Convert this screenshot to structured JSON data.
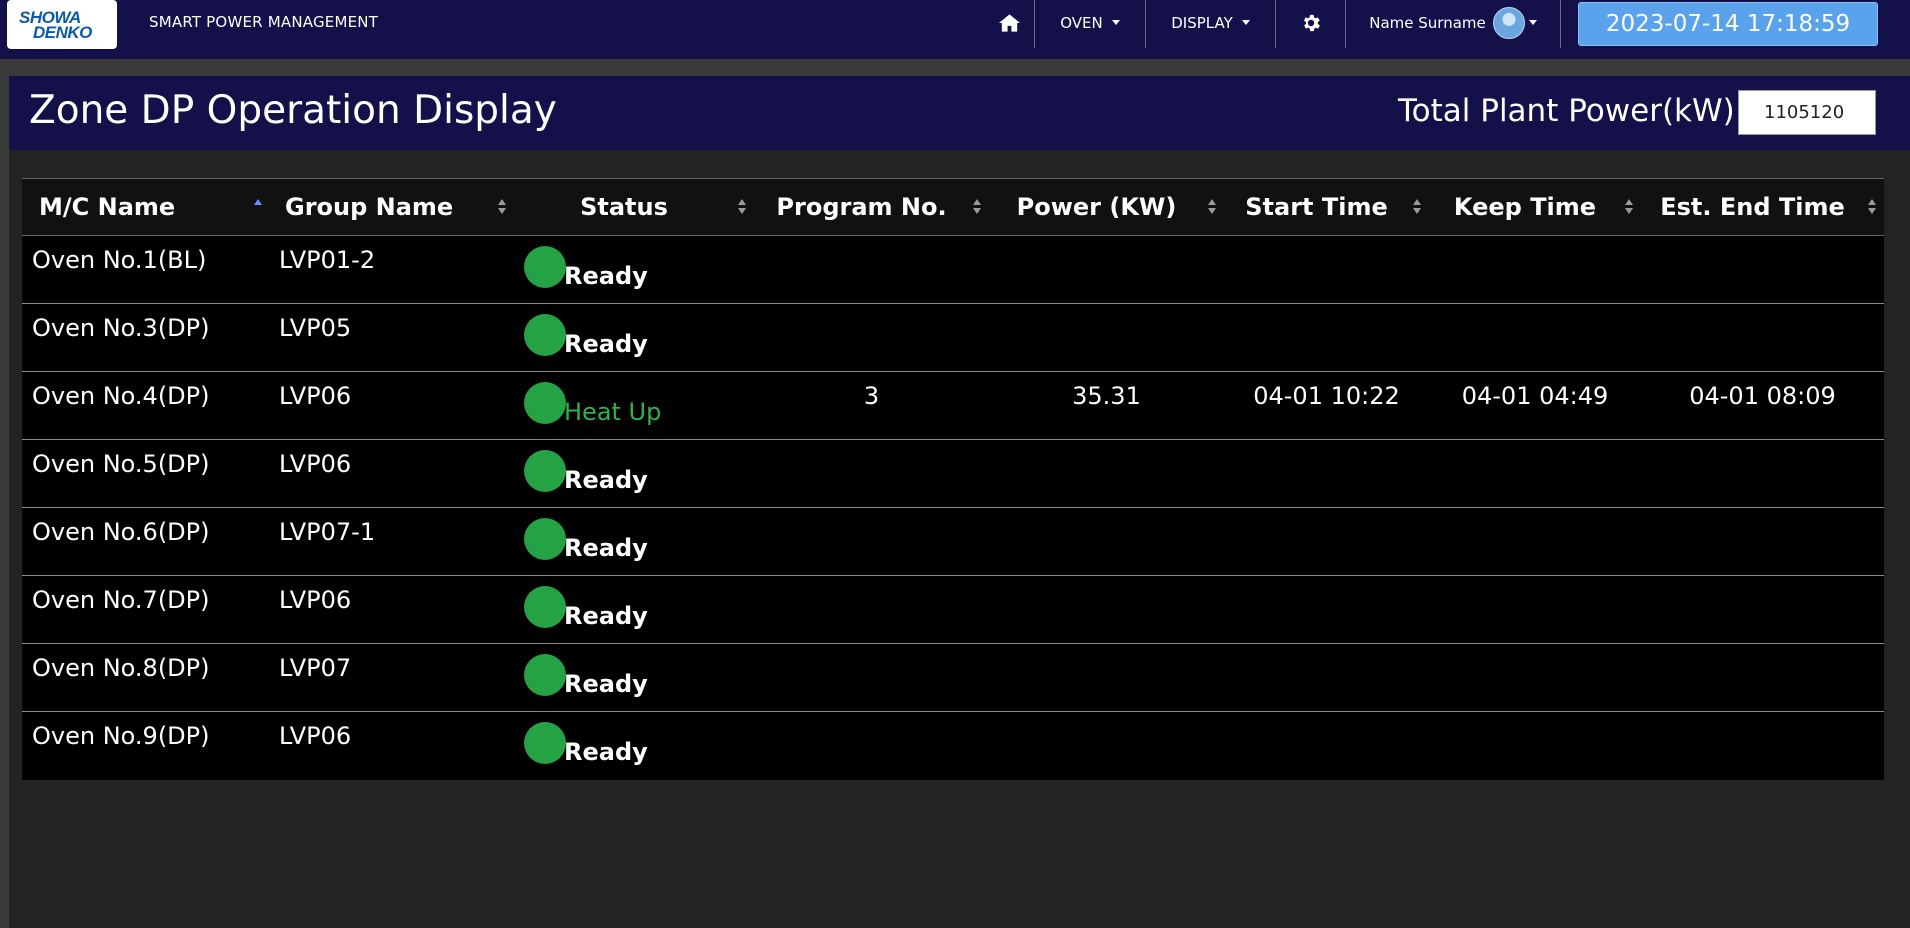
{
  "navbar": {
    "logo_line1": "SHOWA",
    "logo_line2": "DENKO",
    "app_title": "SMART POWER MANAGEMENT",
    "home_icon": "home-icon",
    "menu_oven": "OVEN",
    "menu_display": "DISPLAY",
    "settings_icon": "gear-icon",
    "user_name": "Name Surname",
    "clock": "2023-07-14 17:18:59"
  },
  "page": {
    "title": "Zone DP Operation Display",
    "power_label": "Total Plant Power(kW)",
    "power_value": "1105120"
  },
  "table": {
    "headers": [
      "M/C Name",
      "Group Name",
      "Status",
      "Program No.",
      "Power (KW)",
      "Start Time",
      "Keep Time",
      "Est. End Time"
    ],
    "rows": [
      {
        "mc": "Oven No.1(BL)",
        "group": "LVP01-2",
        "status": "Ready",
        "program": "",
        "power": "",
        "start": "",
        "keep": "",
        "end": ""
      },
      {
        "mc": "Oven No.3(DP)",
        "group": "LVP05",
        "status": "Ready",
        "program": "",
        "power": "",
        "start": "",
        "keep": "",
        "end": ""
      },
      {
        "mc": "Oven No.4(DP)",
        "group": "LVP06",
        "status": "Heat Up",
        "program": "3",
        "power": "35.31",
        "start": "04-01 10:22",
        "keep": "04-01 04:49",
        "end": "04-01 08:09"
      },
      {
        "mc": "Oven No.5(DP)",
        "group": "LVP06",
        "status": "Ready",
        "program": "",
        "power": "",
        "start": "",
        "keep": "",
        "end": ""
      },
      {
        "mc": "Oven No.6(DP)",
        "group": "LVP07-1",
        "status": "Ready",
        "program": "",
        "power": "",
        "start": "",
        "keep": "",
        "end": ""
      },
      {
        "mc": "Oven No.7(DP)",
        "group": "LVP06",
        "status": "Ready",
        "program": "",
        "power": "",
        "start": "",
        "keep": "",
        "end": ""
      },
      {
        "mc": "Oven No.8(DP)",
        "group": "LVP07",
        "status": "Ready",
        "program": "",
        "power": "",
        "start": "",
        "keep": "",
        "end": ""
      },
      {
        "mc": "Oven No.9(DP)",
        "group": "LVP06",
        "status": "Ready",
        "program": "",
        "power": "",
        "start": "",
        "keep": "",
        "end": ""
      }
    ]
  },
  "colors": {
    "navbar_bg": "#13104a",
    "clock_bg": "#5aa3ec",
    "status_dot": "#25a244",
    "status_ready_text": "#ffffff",
    "status_heatup_text": "#2fb347"
  }
}
